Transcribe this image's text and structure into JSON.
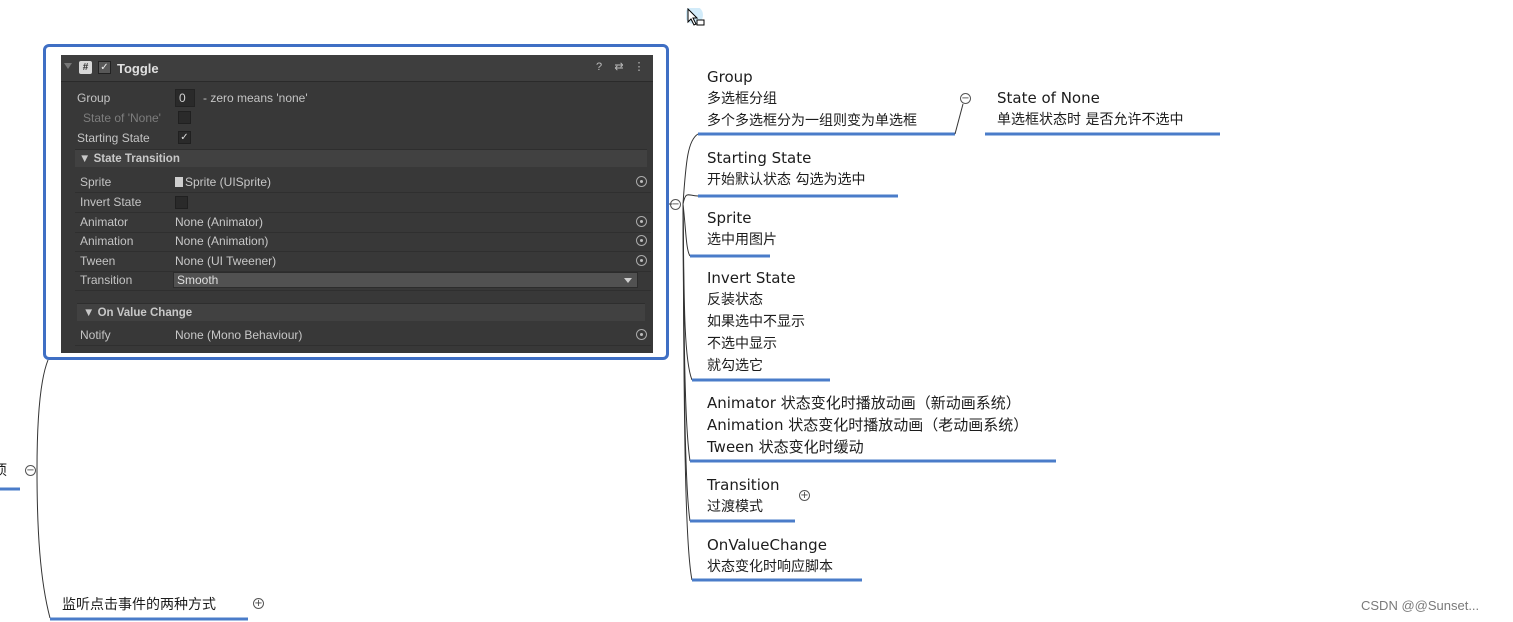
{
  "inspector": {
    "title": "Toggle",
    "group_label": "Group",
    "group_value": "0",
    "group_hint": "- zero means 'none'",
    "state_none_label": "State of 'None'",
    "starting_state_label": "Starting State",
    "starting_state_checked": "✓",
    "section_transition": "▼ State Transition",
    "rows": [
      {
        "label": "Sprite",
        "value": "Sprite (UISprite)"
      },
      {
        "label": "Invert State",
        "value": ""
      },
      {
        "label": "Animator",
        "value": "None (Animator)"
      },
      {
        "label": "Animation",
        "value": "None (Animation)"
      },
      {
        "label": "Tween",
        "value": "None (UI Tweener)"
      },
      {
        "label": "Transition",
        "value": "Smooth"
      }
    ],
    "section_value_change": "▼ On Value Change",
    "notify_label": "Notify",
    "notify_value": "None (Mono Behaviour)"
  },
  "mindmap": {
    "group": {
      "title": "Group",
      "line1": "多选框分组",
      "line2": "多个多选框分为一组则变为单选框"
    },
    "state_none": {
      "title": "State of None",
      "line1": "单选框状态时 是否允许不选中"
    },
    "starting_state": {
      "title": "Starting State",
      "line1": "开始默认状态 勾选为选中"
    },
    "sprite": {
      "title": "Sprite",
      "line1": "选中用图片"
    },
    "invert_state": {
      "title": "Invert State",
      "line1": "反装状态",
      "line2": "如果选中不显示",
      "line3": "不选中显示",
      "line4": "就勾选它"
    },
    "anim": {
      "line1": "Animator  状态变化时播放动画（新动画系统）",
      "line2": "Animation  状态变化时播放动画（老动画系统）",
      "line3": "Tween  状态变化时缓动"
    },
    "transition": {
      "title": "Transition",
      "line1": "过渡模式"
    },
    "on_value_change": {
      "title": "OnValueChange",
      "line1": "状态变化时响应脚本"
    },
    "listen": {
      "title": "监听点击事件的两种方式"
    },
    "left_cut": "项",
    "watermark": "CSDN @@Sunset..."
  },
  "colors": {
    "accent": "#3f6fc4",
    "panel_bg": "#383838",
    "underline": "#4a7cc9"
  },
  "icons": [
    "help-icon",
    "preset-icon",
    "more-icon",
    "collapse-icon",
    "expand-icon",
    "object-picker-icon",
    "cursor-icon"
  ]
}
